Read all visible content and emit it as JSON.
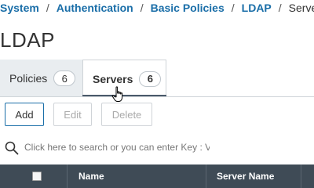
{
  "breadcrumb": {
    "items": [
      "System",
      "Authentication",
      "Basic Policies",
      "LDAP"
    ],
    "separator": "/",
    "current": "Servers"
  },
  "page": {
    "title": "LDAP"
  },
  "tabs": [
    {
      "label": "Policies",
      "count": "6",
      "active": false
    },
    {
      "label": "Servers",
      "count": "6",
      "active": true
    }
  ],
  "toolbar": {
    "add_label": "Add",
    "edit_label": "Edit",
    "delete_label": "Delete"
  },
  "search": {
    "placeholder": "Click here to search or you can enter Key : Va"
  },
  "table": {
    "columns": [
      "Name",
      "Server Name"
    ]
  },
  "colors": {
    "link": "#1a6ea8",
    "header_bg": "#3f4b56",
    "tab_inactive_bg": "#e9edf0",
    "tab_active_underline": "#4a5a6a"
  },
  "icons": {
    "search": "search-icon",
    "cursor": "hand-pointer-icon",
    "select_all": "checkbox-icon"
  }
}
